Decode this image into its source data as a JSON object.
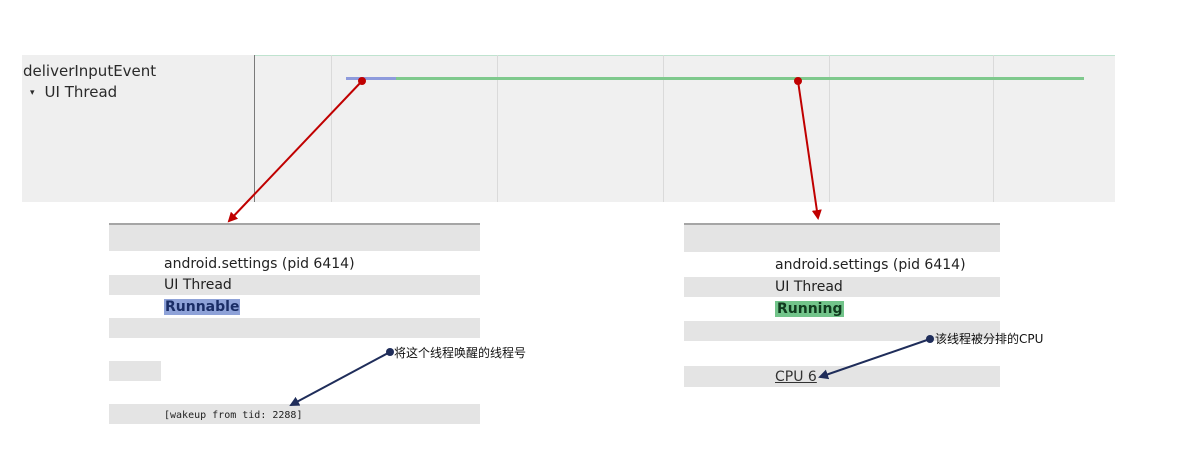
{
  "track": {
    "title": "deliverInputEvent",
    "thread_label": "UI Thread",
    "thread_toggle_glyph": "▾"
  },
  "timeline": {
    "slice_states": [
      "Runnable",
      "Running"
    ],
    "colors": {
      "runnable": "#8e9bdc",
      "running": "#7fc98d",
      "annotation_arrow_red": "#c00000",
      "annotation_arrow_navy": "#1f2d5a"
    }
  },
  "left_panel": {
    "process": "android.settings (pid 6414)",
    "thread": "UI Thread",
    "state": "Runnable",
    "wakeup": "[wakeup from tid: 2288]"
  },
  "right_panel": {
    "process": "android.settings (pid 6414)",
    "thread": "UI Thread",
    "state": "Running",
    "cpu": "CPU 6"
  },
  "annotations": {
    "wakeup_note": "将这个线程唤醒的线程号",
    "cpu_note": "该线程被分排的CPU"
  }
}
